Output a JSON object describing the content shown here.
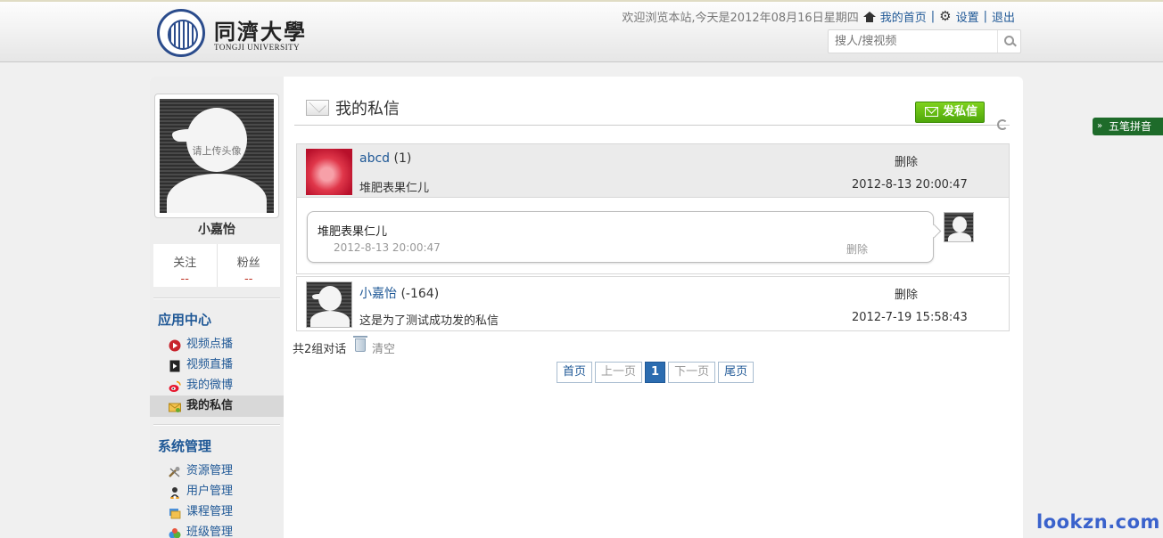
{
  "header": {
    "logo_cn": "同濟大學",
    "logo_en": "TONGJI UNIVERSITY",
    "welcome": "欢迎浏览本站,今天是2012年08月16日星期四",
    "home_link": "我的首页",
    "settings_link": "设置",
    "logout_link": "退出",
    "separator": "|",
    "search_placeholder": "搜人/搜视频"
  },
  "sidebar": {
    "avatar_text": "请上传头像",
    "username": "小嘉怡",
    "stats": [
      {
        "label": "关注",
        "value": "--"
      },
      {
        "label": "粉丝",
        "value": "--"
      }
    ],
    "app_center": {
      "title": "应用中心",
      "items": [
        {
          "label": "视频点播",
          "icon": "play-circle-icon"
        },
        {
          "label": "视频直播",
          "icon": "live-video-icon"
        },
        {
          "label": "我的微博",
          "icon": "weibo-icon"
        },
        {
          "label": "我的私信",
          "icon": "message-icon",
          "active": true
        }
      ]
    },
    "system": {
      "title": "系统管理",
      "items": [
        {
          "label": "资源管理",
          "icon": "tools-icon"
        },
        {
          "label": "用户管理",
          "icon": "user-icon"
        },
        {
          "label": "课程管理",
          "icon": "course-icon"
        },
        {
          "label": "班级管理",
          "icon": "class-icon"
        }
      ]
    }
  },
  "main": {
    "title": "我的私信",
    "send_button": "发私信",
    "threads": [
      {
        "name": "abcd",
        "count": "(1)",
        "delete": "删除",
        "preview": "堆肥表果仁儿",
        "time": "2012-8-13 20:00:47",
        "messages": [
          {
            "text": "堆肥表果仁儿",
            "time": "2012-8-13 20:00:47",
            "delete": "删除"
          }
        ]
      },
      {
        "name": "小嘉怡",
        "count": "(-164)",
        "delete": "删除",
        "preview": "这是为了测试成功发的私信",
        "time": "2012-7-19 15:58:43"
      }
    ],
    "summary": "共2组对话",
    "clear": "清空",
    "pagination": {
      "first": "首页",
      "prev": "上一页",
      "current": "1",
      "next": "下一页",
      "last": "尾页"
    }
  },
  "overlay": {
    "ime": "五笔拼音",
    "watermark": "lookzn.com"
  },
  "colors": {
    "link": "#1f5896",
    "send_button": "#5bb312",
    "pager_current": "#2b6cb0",
    "ime_bar": "#1e6b2a",
    "watermark": "#3a62cc"
  }
}
